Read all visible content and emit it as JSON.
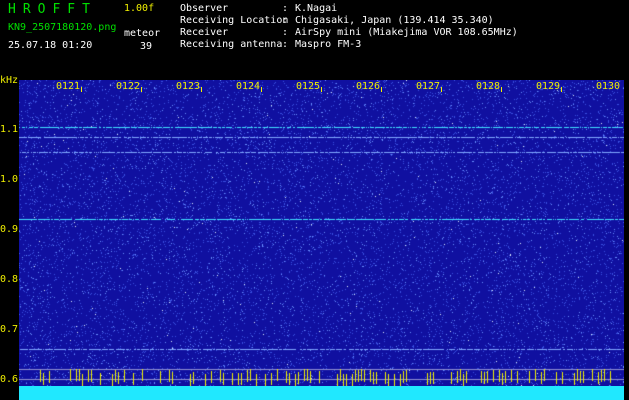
{
  "header": {
    "brand": "HROFFT",
    "version": "1.00f",
    "filename": "KN9_2507180120.png",
    "datetime": "25.07.18 01:20",
    "meteor_label": "meteor",
    "meteor_count": "39",
    "info": [
      {
        "key": "Observer",
        "value": "K.Nagai"
      },
      {
        "key": "Receiving Location",
        "value": "Chigasaki, Japan (139.414 35.340)"
      },
      {
        "key": "Receiver",
        "value": "AirSpy mini (Miakejima VOR 108.65MHz)"
      },
      {
        "key": "Receiving antenna",
        "value": "Maspro FM-3"
      }
    ],
    "separator": ":"
  },
  "y_axis": {
    "unit": "kHz",
    "ticks": [
      "1.1",
      "1.0",
      "0.9",
      "0.8",
      "0.7",
      "0.6"
    ]
  },
  "x_axis": {
    "ticks": [
      "0121",
      "0122",
      "0123",
      "0124",
      "0125",
      "0126",
      "0127",
      "0128",
      "0129",
      "0130"
    ]
  },
  "colors": {
    "background": "#1010a0",
    "noise": "#4a6cff",
    "signal": "#40e0ff",
    "baseline": "#20e8ff",
    "tick_text": "#f0f000"
  },
  "signal_lines_khz": [
    1.105,
    1.085,
    1.055,
    0.92,
    0.66
  ]
}
